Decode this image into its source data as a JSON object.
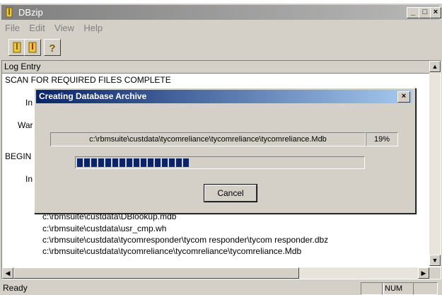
{
  "window": {
    "title": "DBzip",
    "controls": {
      "minimize": "_",
      "maximize": "□",
      "close": "×"
    }
  },
  "menu": [
    "File",
    "Edit",
    "View",
    "Help"
  ],
  "toolbar": {
    "icons": [
      "zip-icon",
      "unzip-icon",
      "help-icon"
    ]
  },
  "log": {
    "header": "Log Entry",
    "lines": [
      "SCAN FOR REQUIRED FILES COMPLETE",
      "In",
      "War",
      "BEGIN",
      "In",
      "c:\\rbmsuite\\custdata\\DBlookup.mdb",
      "c:\\rbmsuite\\custdata\\usr_cmp.wh",
      "c:\\rbmsuite\\custdata\\tycomresponder\\tycom responder\\tycom responder.dbz",
      "c:\\rbmsuite\\custdata\\tycomreliance\\tycomreliance\\tycomreliance.Mdb"
    ]
  },
  "status": {
    "text": "Ready",
    "num": "NUM"
  },
  "dialog": {
    "title": "Creating Database Archive",
    "close": "×",
    "file": "c:\\rbmsuite\\custdata\\tycomreliance\\tycomreliance\\tycomreliance.Mdb",
    "percent": "19%",
    "progress_fraction": 0.39,
    "cancel_label": "Cancel"
  }
}
